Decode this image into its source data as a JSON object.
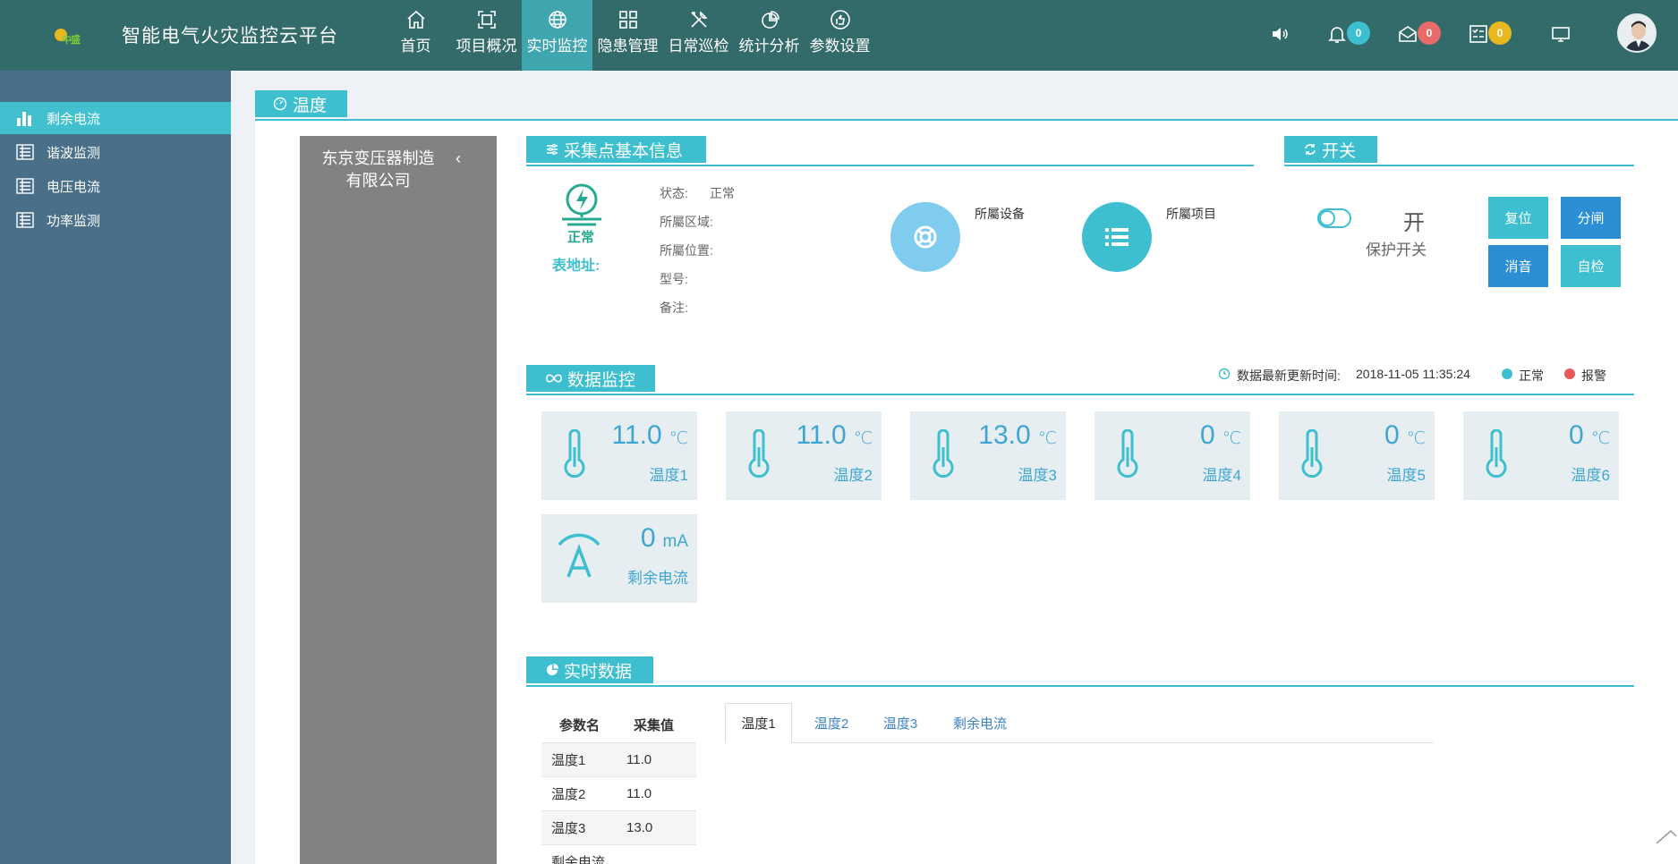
{
  "header": {
    "logo_text": "中盛",
    "app_title": "智能电气火灾监控云平台",
    "nav": [
      "首页",
      "项目概况",
      "实时监控",
      "隐患管理",
      "日常巡检",
      "统计分析",
      "参数设置"
    ],
    "active_nav": "实时监控",
    "badges": {
      "notifications": "0",
      "messages": "0",
      "tasks": "0"
    },
    "badge_colors": {
      "notifications": "#3ebfcf",
      "messages": "#e86a6a",
      "tasks": "#e8b820"
    }
  },
  "sidebar": {
    "items": [
      {
        "label": "剩余电流",
        "active": true
      },
      {
        "label": "谐波监测"
      },
      {
        "label": "电压电流"
      },
      {
        "label": "功率监测"
      }
    ]
  },
  "main": {
    "heading": "温度",
    "company": "东京变压器制造有限公司",
    "collapse_icon": "chevron-left-icon"
  },
  "collect_info": {
    "title": "采集点基本信息",
    "status_word": "正常",
    "meter_address_label": "表地址:",
    "fields": [
      {
        "label": "状态:",
        "value": "正常"
      },
      {
        "label": "所屬区域:",
        "value": ""
      },
      {
        "label": "所屬位置:",
        "value": ""
      },
      {
        "label": "型号:",
        "value": ""
      },
      {
        "label": "备注:",
        "value": ""
      }
    ],
    "device_label": "所屬设备",
    "project_label": "所屬项目"
  },
  "switch": {
    "title": "开关",
    "state": "开",
    "label": "保护开关",
    "buttons": [
      {
        "label": "复位",
        "color": "#3ebfcf"
      },
      {
        "label": "分闸",
        "color": "#2c8fd6"
      },
      {
        "label": "消音",
        "color": "#2c8fd6"
      },
      {
        "label": "自检",
        "color": "#3ebfcf"
      }
    ]
  },
  "data_monitor": {
    "title": "数据监控",
    "update_label": "数据最新更新时间:",
    "update_time": "2018-11-05 11:35:24",
    "legend": [
      {
        "label": "正常",
        "color": "#3ebfcf"
      },
      {
        "label": "报警",
        "color": "#e85858"
      }
    ],
    "cards": [
      {
        "value": "11.0",
        "unit": "℃",
        "label": "温度1"
      },
      {
        "value": "11.0",
        "unit": "℃",
        "label": "温度2"
      },
      {
        "value": "13.0",
        "unit": "℃",
        "label": "温度3"
      },
      {
        "value": "0",
        "unit": "℃",
        "label": "温度4"
      },
      {
        "value": "0",
        "unit": "℃",
        "label": "温度5"
      },
      {
        "value": "0",
        "unit": "℃",
        "label": "温度6"
      },
      {
        "value": "0",
        "unit": "mA",
        "label": "剩余电流"
      }
    ]
  },
  "realtime": {
    "title": "实时数据",
    "table_headers": [
      "参数名",
      "采集值"
    ],
    "rows": [
      [
        "温度1",
        "11.0"
      ],
      [
        "温度2",
        "11.0"
      ],
      [
        "温度3",
        "13.0"
      ],
      [
        "剩余电流",
        ""
      ]
    ],
    "tabs": [
      "温度1",
      "温度2",
      "温度3",
      "剩余电流"
    ],
    "active_tab": "温度1"
  }
}
